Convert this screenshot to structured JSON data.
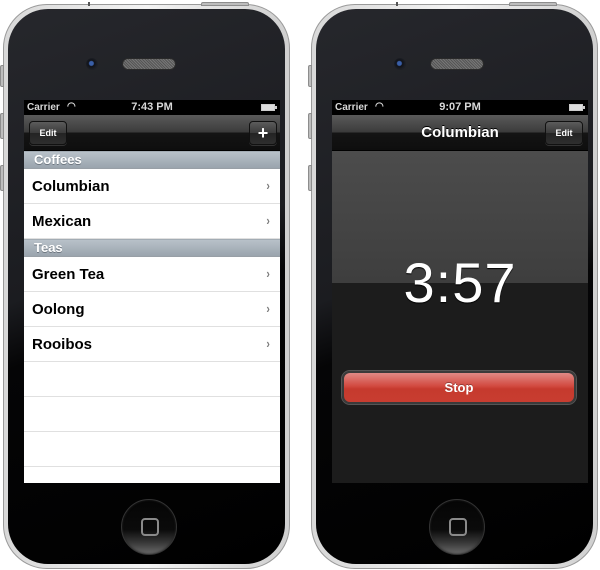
{
  "left_phone": {
    "status_bar": {
      "carrier": "Carrier",
      "wifi_icon": "wifi-icon",
      "time": "7:43 PM",
      "battery_icon": "battery-icon"
    },
    "nav_bar": {
      "edit_label": "Edit",
      "add_label": "+"
    },
    "sections": [
      {
        "header": "Coffees",
        "items": [
          {
            "label": "Columbian"
          },
          {
            "label": "Mexican"
          }
        ]
      },
      {
        "header": "Teas",
        "items": [
          {
            "label": "Green Tea"
          },
          {
            "label": "Oolong"
          },
          {
            "label": "Rooibos"
          }
        ]
      }
    ],
    "chevron": "›"
  },
  "right_phone": {
    "status_bar": {
      "carrier": "Carrier",
      "wifi_icon": "wifi-icon",
      "time": "9:07 PM",
      "battery_icon": "battery-icon"
    },
    "nav_bar": {
      "title": "Columbian",
      "edit_label": "Edit"
    },
    "timer": {
      "remaining": "3:57"
    },
    "stop_label": "Stop",
    "colors": {
      "stop_button": "#c83d30"
    }
  },
  "glyphs": {
    "wifi": "◠"
  }
}
